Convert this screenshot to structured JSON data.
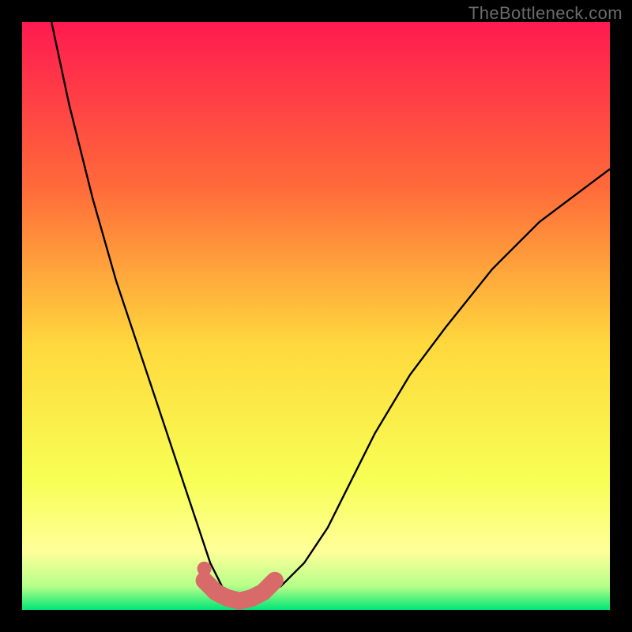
{
  "watermark": "TheBottleneck.com",
  "colors": {
    "gradient_top": "#ff1a50",
    "gradient_upper": "#ff6a3a",
    "gradient_mid": "#ffd93d",
    "gradient_lower": "#f7ff55",
    "gradient_bottom_yellow": "#ffff99",
    "gradient_green": "#00e676",
    "curve": "#000000",
    "marker": "#d86a6a",
    "frame": "#000000"
  },
  "chart_data": {
    "type": "line",
    "title": "",
    "xlabel": "",
    "ylabel": "",
    "xlim": [
      0,
      100
    ],
    "ylim": [
      0,
      100
    ],
    "series": [
      {
        "name": "bottleneck-curve",
        "x": [
          5,
          8,
          12,
          16,
          20,
          24,
          28,
          30,
          32,
          34,
          36,
          38,
          40,
          44,
          48,
          52,
          56,
          60,
          66,
          72,
          80,
          88,
          96,
          100
        ],
        "y": [
          100,
          86,
          70,
          56,
          44,
          32,
          20,
          14,
          8,
          4,
          2,
          1.5,
          2,
          4,
          8,
          14,
          22,
          30,
          40,
          48,
          58,
          66,
          72,
          75
        ]
      },
      {
        "name": "highlighted-range",
        "x": [
          31,
          33,
          35,
          37,
          39,
          41,
          43
        ],
        "y": [
          5,
          3,
          2,
          1.5,
          2,
          3,
          5
        ]
      }
    ],
    "markers": [
      {
        "name": "marker-dot",
        "x": 31,
        "y": 7
      }
    ],
    "annotations": []
  }
}
